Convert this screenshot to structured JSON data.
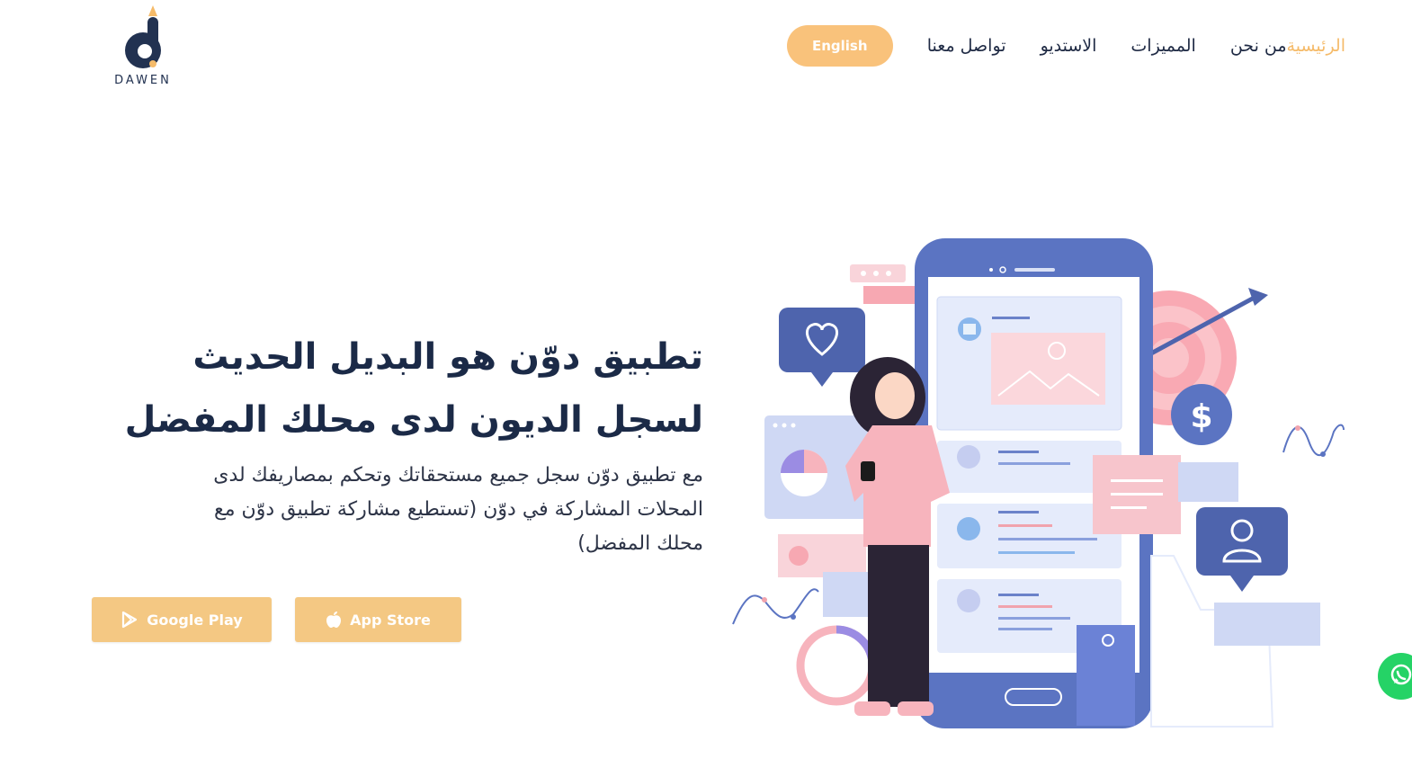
{
  "brand": {
    "name": "DAWEN"
  },
  "nav": {
    "items": [
      {
        "label": "الرئيسية",
        "active": true
      },
      {
        "label": "من نحن",
        "active": false
      },
      {
        "label": "المميزات",
        "active": false
      },
      {
        "label": "الاستديو",
        "active": false
      },
      {
        "label": "تواصل معنا",
        "active": false
      }
    ],
    "language_button": "English"
  },
  "hero": {
    "title_line1": "تطبيق دوّن هو البديل الحديث",
    "title_line2": "لسجل الديون لدى محلك المفضل",
    "subtitle_line1": "مع تطبيق دوّن سجل جميع مستحقاتك وتحكم بمصاريفك لدى",
    "subtitle_line2": "المحلات المشاركة في دوّن (تستطيع مشاركة تطبيق دوّن مع",
    "subtitle_line3": "محلك المفضل)"
  },
  "downloads": {
    "google_play": "Google Play",
    "app_store": "App Store"
  },
  "icons": [
    "google-play-icon",
    "apple-icon",
    "whatsapp-icon",
    "heart-icon",
    "user-icon",
    "dollar-icon",
    "shopping-bag-icon",
    "target-icon"
  ],
  "colors": {
    "accent": "#f9c27b",
    "button": "#f4c883",
    "primary_dark": "#1b2a47",
    "phone_blue": "#5b74c2",
    "pink": "#f7b4bd",
    "whatsapp": "#25d366"
  }
}
